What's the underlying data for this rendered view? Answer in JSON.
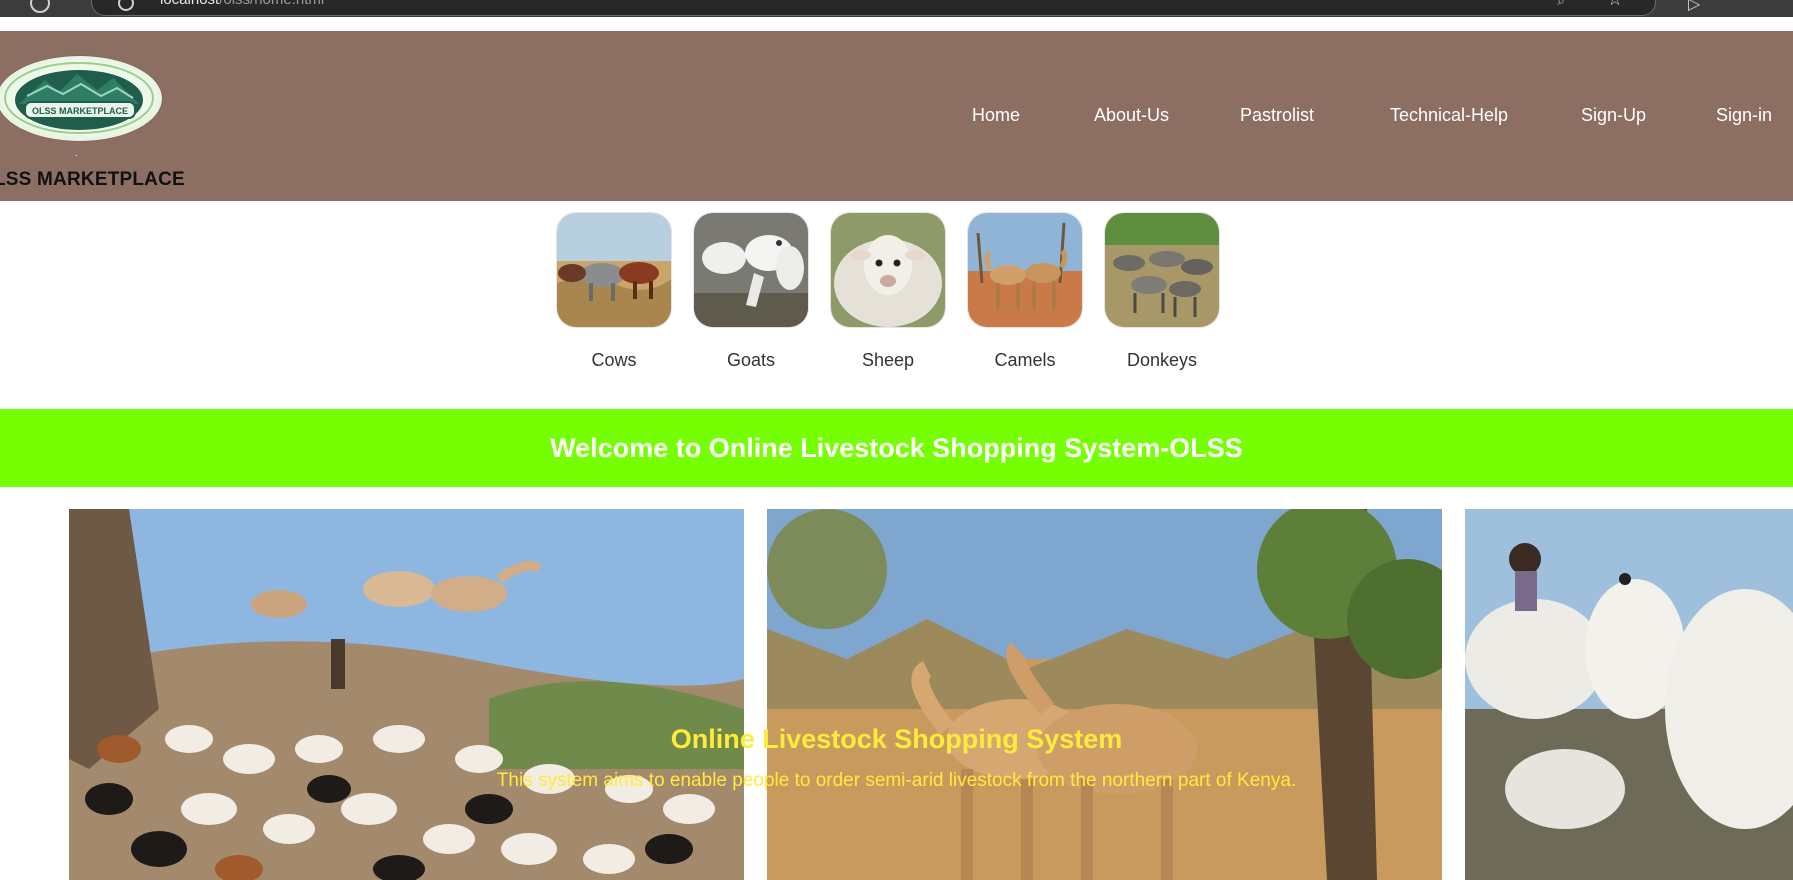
{
  "browser": {
    "url_host": "localhost",
    "url_path": "/olss/home.html",
    "info_icon": "info-icon",
    "star_icon": "star-icon"
  },
  "brand": {
    "logo_text": "OLSS MARKETPLACE",
    "name": "LSS MARKETPLACE"
  },
  "nav": {
    "items": [
      {
        "label": "Home"
      },
      {
        "label": "About-Us"
      },
      {
        "label": "Pastrolist"
      },
      {
        "label": "Technical-Help"
      },
      {
        "label": "Sign-Up"
      },
      {
        "label": "Sign-in"
      }
    ]
  },
  "categories": [
    {
      "label": "Cows"
    },
    {
      "label": "Goats"
    },
    {
      "label": "Sheep"
    },
    {
      "label": "Camels"
    },
    {
      "label": "Donkeys"
    }
  ],
  "welcome": {
    "title": "Welcome to Online Livestock Shopping System-OLSS"
  },
  "hero": {
    "title": "Online Livestock Shopping System",
    "subtitle": "This system aims to enable people to order semi-arid livestock from the northern part of Kenya."
  },
  "colors": {
    "header_bg": "#8d6e63",
    "banner_bg": "#76ff03",
    "hero_text": "#ffeb3b"
  }
}
